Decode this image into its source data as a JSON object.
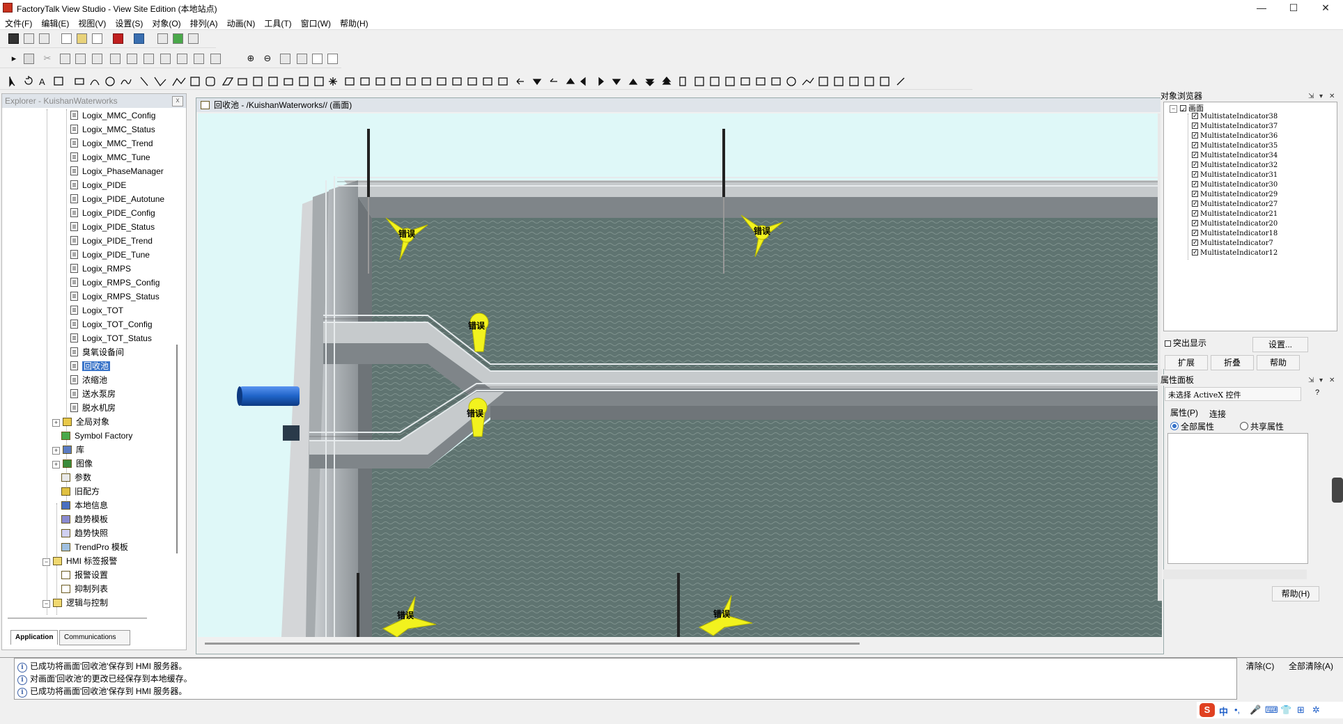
{
  "window": {
    "title": "FactoryTalk View Studio - View Site Edition  (本地站点)",
    "controls": [
      "—",
      "☐",
      "✕"
    ]
  },
  "menu": [
    "文件(F)",
    "编辑(E)",
    "视图(V)",
    "设置(S)",
    "对象(O)",
    "排列(A)",
    "动画(N)",
    "工具(T)",
    "窗口(W)",
    "帮助(H)"
  ],
  "explorer": {
    "title": "Explorer - KuishanWaterworks",
    "close": "x",
    "items": [
      {
        "label": "Logix_MMC_Config",
        "icon": "file"
      },
      {
        "label": "Logix_MMC_Status",
        "icon": "file"
      },
      {
        "label": "Logix_MMC_Trend",
        "icon": "file"
      },
      {
        "label": "Logix_MMC_Tune",
        "icon": "file"
      },
      {
        "label": "Logix_PhaseManager",
        "icon": "file"
      },
      {
        "label": "Logix_PIDE",
        "icon": "file"
      },
      {
        "label": "Logix_PIDE_Autotune",
        "icon": "file"
      },
      {
        "label": "Logix_PIDE_Config",
        "icon": "file"
      },
      {
        "label": "Logix_PIDE_Status",
        "icon": "file"
      },
      {
        "label": "Logix_PIDE_Trend",
        "icon": "file"
      },
      {
        "label": "Logix_PIDE_Tune",
        "icon": "file"
      },
      {
        "label": "Logix_RMPS",
        "icon": "file"
      },
      {
        "label": "Logix_RMPS_Config",
        "icon": "file"
      },
      {
        "label": "Logix_RMPS_Status",
        "icon": "file"
      },
      {
        "label": "Logix_TOT",
        "icon": "file"
      },
      {
        "label": "Logix_TOT_Config",
        "icon": "file"
      },
      {
        "label": "Logix_TOT_Status",
        "icon": "file"
      },
      {
        "label": "臭氧设备间",
        "icon": "file"
      },
      {
        "label": "回收池",
        "icon": "file",
        "selected": true
      },
      {
        "label": "浓缩池",
        "icon": "file"
      },
      {
        "label": "送水泵房",
        "icon": "file"
      },
      {
        "label": "脱水机房",
        "icon": "file"
      },
      {
        "label": "全局对象",
        "icon": "group",
        "expander": "+"
      },
      {
        "label": "Symbol Factory",
        "icon": "group"
      },
      {
        "label": "库",
        "icon": "group",
        "expander": "+"
      },
      {
        "label": "图像",
        "icon": "group",
        "expander": "+"
      },
      {
        "label": "参数",
        "icon": "group"
      },
      {
        "label": "旧配方",
        "icon": "group"
      },
      {
        "label": "本地信息",
        "icon": "group"
      },
      {
        "label": "趋势模板",
        "icon": "group"
      },
      {
        "label": "趋势快照",
        "icon": "group"
      },
      {
        "label": "TrendPro 模板",
        "icon": "group"
      },
      {
        "label": "HMI 标签报警",
        "icon": "folder",
        "expander": "−"
      },
      {
        "label": "报警设置",
        "icon": "group"
      },
      {
        "label": "抑制列表",
        "icon": "group"
      },
      {
        "label": "逻辑与控制",
        "icon": "folder",
        "expander": "−"
      }
    ],
    "tabs": [
      "Application",
      "Communications"
    ]
  },
  "canvas": {
    "title": "回收池 - /KuishanWaterworks// (画面)",
    "aerator_label": "错误"
  },
  "object_browser": {
    "title": "对象浏览器",
    "root": "画面",
    "items": [
      "MultistateIndicator38",
      "MultistateIndicator37",
      "MultistateIndicator36",
      "MultistateIndicator35",
      "MultistateIndicator34",
      "MultistateIndicator32",
      "MultistateIndicator31",
      "MultistateIndicator30",
      "MultistateIndicator29",
      "MultistateIndicator27",
      "MultistateIndicator21",
      "MultistateIndicator20",
      "MultistateIndicator18",
      "MultistateIndicator7",
      "MultistateIndicator12"
    ],
    "highlight_label": "突出显示",
    "settings_button": "设置...",
    "expand_button": "扩展",
    "collapse_button": "折叠",
    "help_button": "帮助"
  },
  "properties": {
    "title": "属性面板",
    "object_select": "未选择 ActiveX 控件",
    "help_q": "?",
    "tab_props": "属性(P)",
    "tab_connect": "连接",
    "radio_all": "全部属性",
    "radio_shared": "共享属性",
    "help_button": "帮助(H)"
  },
  "output": {
    "lines": [
      "已成功将画面'回收池'保存到 HMI 服务器。",
      "对画面'回收池'的更改已经保存到本地缓存。",
      "已成功将画面'回收池'保存到 HMI 服务器。"
    ],
    "clear_button": "清除(C)",
    "clear_all_button": "全部清除(A)"
  },
  "tray": [
    "S",
    "中",
    "•,",
    "🎤",
    "⌨",
    "👕",
    "⊞",
    "✲"
  ],
  "colors": {
    "accent": "#3873c8",
    "water": "#5e7370",
    "aerator": "#f2f21e",
    "pipe": "#1f63c8"
  }
}
